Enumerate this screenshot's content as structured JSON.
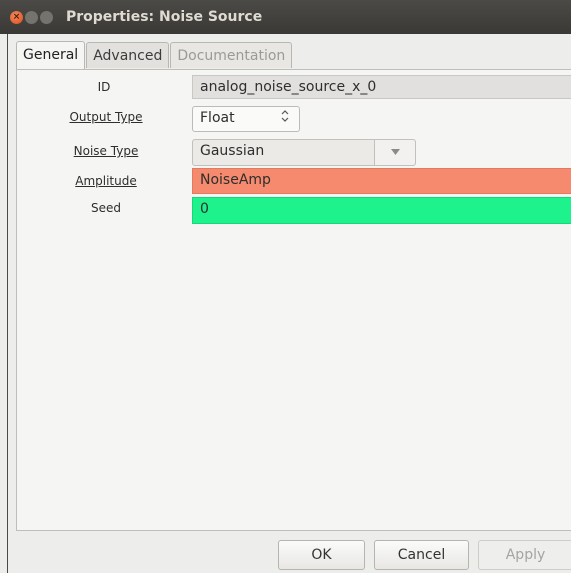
{
  "window": {
    "title": "Properties: Noise Source",
    "controls": {
      "close": "×",
      "minimize": "",
      "maximize": ""
    }
  },
  "tabs": [
    {
      "label": "General",
      "state": "active"
    },
    {
      "label": "Advanced",
      "state": "normal"
    },
    {
      "label": "Documentation",
      "state": "disabled"
    }
  ],
  "params": {
    "id": {
      "label": "ID",
      "value": "analog_noise_source_x_0"
    },
    "output_type": {
      "label": "Output Type",
      "value": "Float",
      "arrows": "⌃⌄"
    },
    "noise_type": {
      "label": "Noise Type",
      "value": "Gaussian",
      "dropdown_glyph": "▼"
    },
    "amplitude": {
      "label": "Amplitude",
      "value": "NoiseAmp",
      "color": "#f58a6e"
    },
    "seed": {
      "label": "Seed",
      "value": "0",
      "color": "#1ef28c"
    }
  },
  "buttons": {
    "ok": "OK",
    "cancel": "Cancel",
    "apply": "Apply"
  },
  "colors": {
    "titlebar": "#3a3935",
    "close_button": "#de4d1d",
    "panel_background": "#f5f5f4"
  }
}
